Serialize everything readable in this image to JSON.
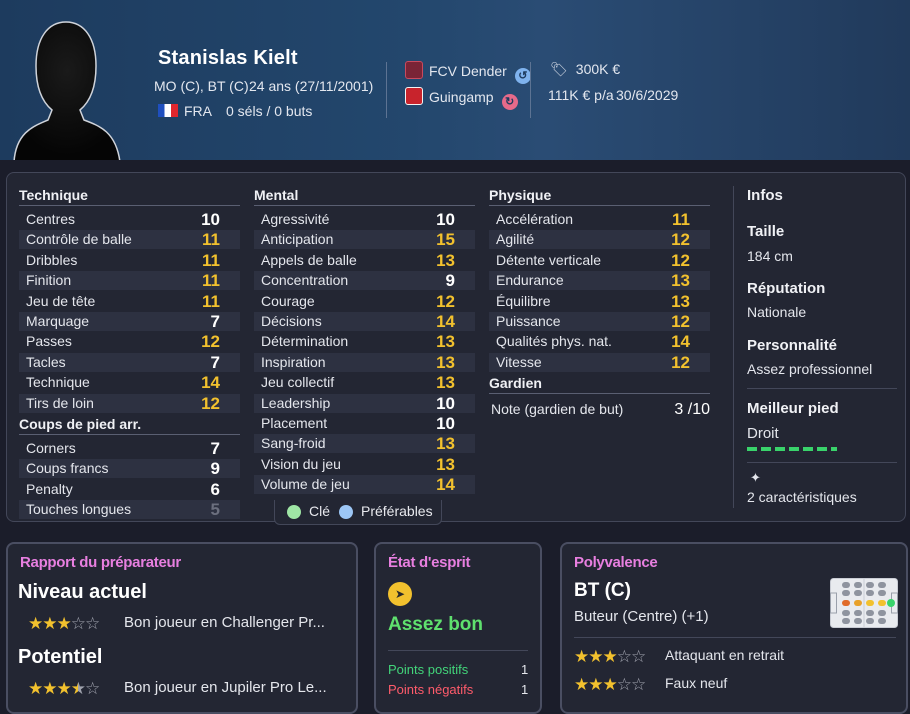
{
  "player": {
    "name": "Stanislas Kielt",
    "positions": "MO (C), BT (C)",
    "age": "24 ans (27/11/2001)",
    "nationality": "FRA",
    "caps": "0 séls / 0 buts",
    "club": "FCV Dender",
    "loan_club": "Guingamp",
    "value": "300K €",
    "wage": "111K € p/a",
    "contract_end": "30/6/2029"
  },
  "attributes": {
    "technique": {
      "title": "Technique",
      "items": [
        {
          "label": "Centres",
          "value": "10",
          "tier": "white"
        },
        {
          "label": "Contrôle de balle",
          "value": "11",
          "tier": "yellow"
        },
        {
          "label": "Dribbles",
          "value": "11",
          "tier": "yellow"
        },
        {
          "label": "Finition",
          "value": "11",
          "tier": "yellow"
        },
        {
          "label": "Jeu de tête",
          "value": "11",
          "tier": "yellow"
        },
        {
          "label": "Marquage",
          "value": "7",
          "tier": "white"
        },
        {
          "label": "Passes",
          "value": "12",
          "tier": "yellow"
        },
        {
          "label": "Tacles",
          "value": "7",
          "tier": "white"
        },
        {
          "label": "Technique",
          "value": "14",
          "tier": "yellow"
        },
        {
          "label": "Tirs de loin",
          "value": "12",
          "tier": "yellow"
        }
      ]
    },
    "set_pieces": {
      "title": "Coups de pied arr.",
      "items": [
        {
          "label": "Corners",
          "value": "7",
          "tier": "white"
        },
        {
          "label": "Coups francs",
          "value": "9",
          "tier": "white"
        },
        {
          "label": "Penalty",
          "value": "6",
          "tier": "white"
        },
        {
          "label": "Touches longues",
          "value": "5",
          "tier": "grey"
        }
      ]
    },
    "mental": {
      "title": "Mental",
      "items": [
        {
          "label": "Agressivité",
          "value": "10",
          "tier": "white"
        },
        {
          "label": "Anticipation",
          "value": "15",
          "tier": "yellow"
        },
        {
          "label": "Appels de balle",
          "value": "13",
          "tier": "yellow"
        },
        {
          "label": "Concentration",
          "value": "9",
          "tier": "white"
        },
        {
          "label": "Courage",
          "value": "12",
          "tier": "yellow"
        },
        {
          "label": "Décisions",
          "value": "14",
          "tier": "yellow"
        },
        {
          "label": "Détermination",
          "value": "13",
          "tier": "yellow"
        },
        {
          "label": "Inspiration",
          "value": "13",
          "tier": "yellow"
        },
        {
          "label": "Jeu collectif",
          "value": "13",
          "tier": "yellow"
        },
        {
          "label": "Leadership",
          "value": "10",
          "tier": "white"
        },
        {
          "label": "Placement",
          "value": "10",
          "tier": "white"
        },
        {
          "label": "Sang-froid",
          "value": "13",
          "tier": "yellow"
        },
        {
          "label": "Vision du jeu",
          "value": "13",
          "tier": "yellow"
        },
        {
          "label": "Volume de jeu",
          "value": "14",
          "tier": "yellow"
        }
      ]
    },
    "physique": {
      "title": "Physique",
      "items": [
        {
          "label": "Accélération",
          "value": "11",
          "tier": "yellow"
        },
        {
          "label": "Agilité",
          "value": "12",
          "tier": "yellow"
        },
        {
          "label": "Détente verticale",
          "value": "12",
          "tier": "yellow"
        },
        {
          "label": "Endurance",
          "value": "13",
          "tier": "yellow"
        },
        {
          "label": "Équilibre",
          "value": "13",
          "tier": "yellow"
        },
        {
          "label": "Puissance",
          "value": "12",
          "tier": "yellow"
        },
        {
          "label": "Qualités phys. nat.",
          "value": "14",
          "tier": "yellow"
        },
        {
          "label": "Vitesse",
          "value": "12",
          "tier": "yellow"
        }
      ]
    },
    "goalkeeper": {
      "title": "Gardien",
      "label": "Note (gardien de but)",
      "value": "3 /10"
    }
  },
  "legend": {
    "key": "Clé",
    "preferred": "Préférables"
  },
  "infos": {
    "title": "Infos",
    "height_label": "Taille",
    "height": "184 cm",
    "reputation_label": "Réputation",
    "reputation": "Nationale",
    "personality_label": "Personnalité",
    "personality": "Assez professionnel",
    "foot_label": "Meilleur pied",
    "foot": "Droit",
    "traits": "2 caractéristiques"
  },
  "scout": {
    "title": "Rapport du préparateur",
    "current_label": "Niveau actuel",
    "current_stars": 3,
    "current_text": "Bon joueur en Challenger Pr...",
    "potential_label": "Potentiel",
    "potential_stars": 3.5,
    "potential_text": "Bon joueur en Jupiler Pro Le..."
  },
  "morale": {
    "title": "État d'esprit",
    "status": "Assez bon",
    "positive_label": "Points positifs",
    "positive_count": "1",
    "negative_label": "Points négatifs",
    "negative_count": "1"
  },
  "versatility": {
    "title": "Polyvalence",
    "position": "BT (C)",
    "role": "Buteur (Centre) (+1)",
    "alt1_label": "Attaquant en retrait",
    "alt1_stars": 3,
    "alt2_label": "Faux neuf",
    "alt2_stars": 3
  },
  "colors": {
    "accent_title": "#e87fe0",
    "good": "#5fe06e",
    "positive": "#42d47a",
    "negative": "#ff5b6b",
    "attr_yellow": "#f2c12e"
  }
}
